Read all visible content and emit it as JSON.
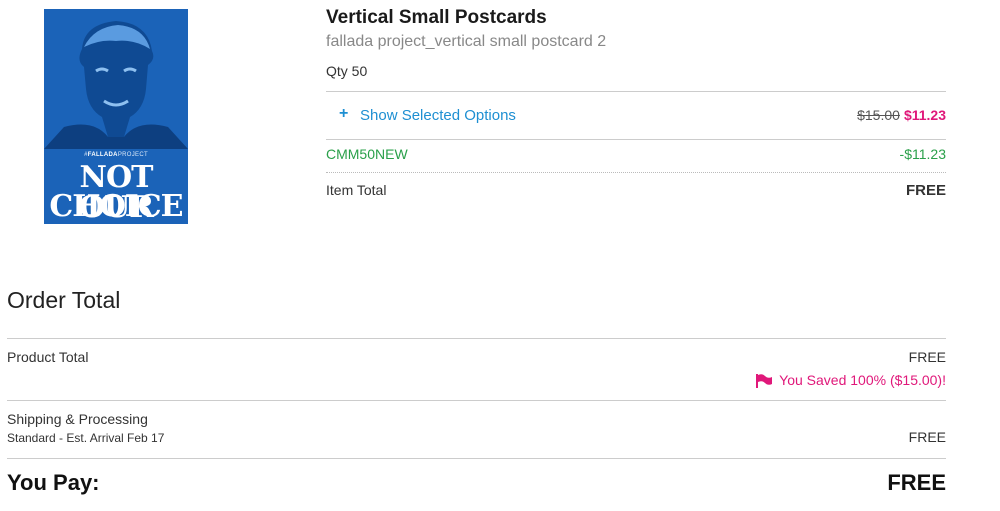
{
  "product_image": {
    "brand_tag_prefix": "#",
    "brand_tag_bold": "FALLADA",
    "brand_tag_rest": "PROJECT",
    "line1": "NOT OUR",
    "line2": "CHOICE",
    "background_color": "#1b63b8"
  },
  "item": {
    "title": "Vertical Small Postcards",
    "subtitle": "fallada project_vertical small postcard 2",
    "qty": "Qty 50",
    "options_icon": "+",
    "options_label": "Show Selected Options",
    "original_price": "$15.00",
    "sale_price": "$11.23",
    "coupon_code": "CMM50NEW",
    "coupon_amount": "-$11.23",
    "item_total_label": "Item Total",
    "item_total_value": "FREE"
  },
  "order": {
    "heading": "Order Total",
    "product_total_label": "Product Total",
    "product_total_value": "FREE",
    "saved_icon": "flag-icon",
    "saved_text": "You Saved 100% ($15.00)!",
    "shipping_label": "Shipping & Processing",
    "shipping_detail": "Standard - Est. Arrival Feb 17",
    "shipping_value": "FREE",
    "pay_label": "You Pay:",
    "pay_value": "FREE"
  },
  "colors": {
    "accent_blue": "#1e8fd2",
    "sale_pink": "#e0187a",
    "coupon_green": "#2aa04a"
  }
}
